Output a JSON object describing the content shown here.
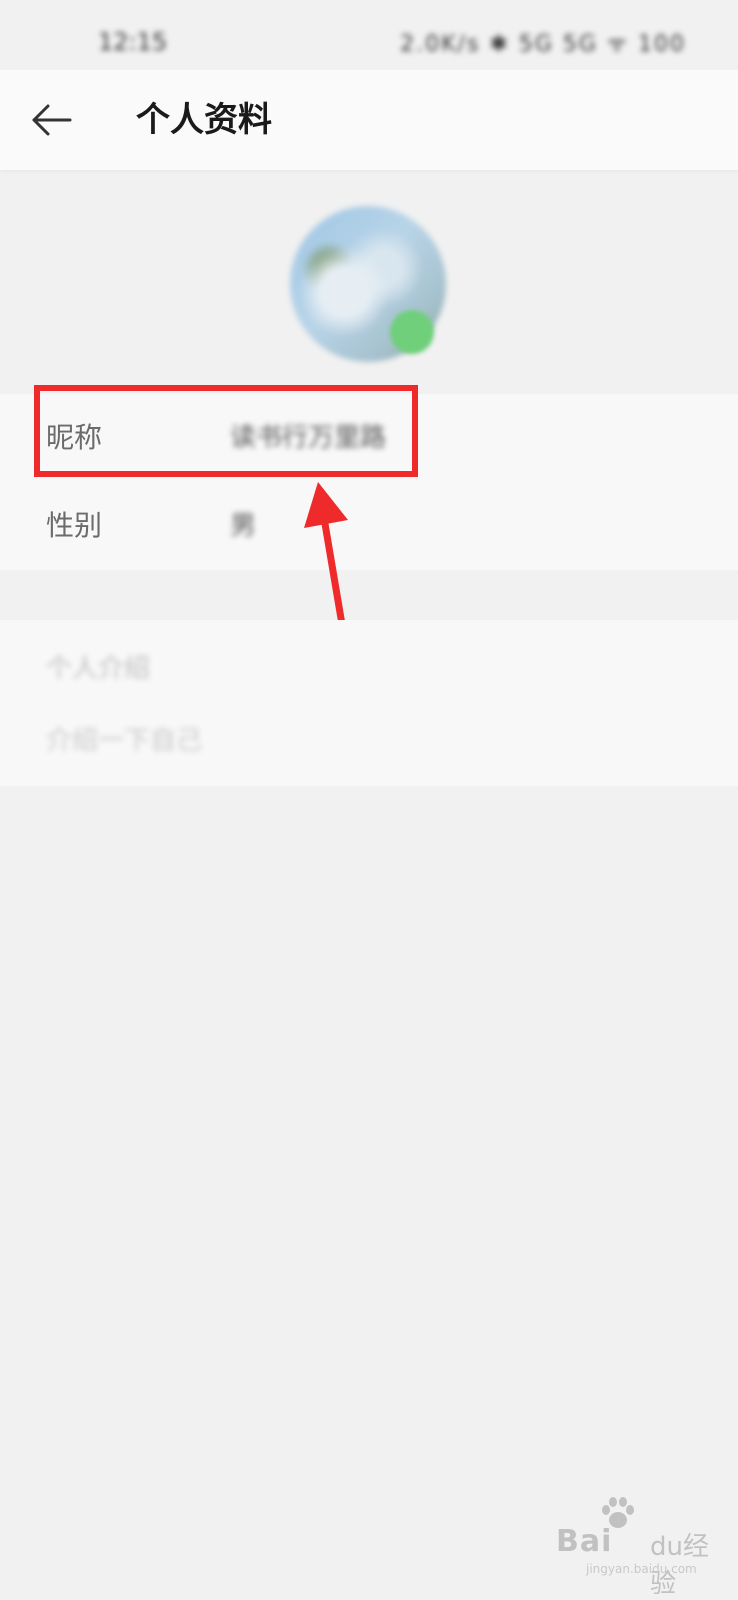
{
  "status_bar": {
    "time": "12:15",
    "indicators": "2.0K/s ✱ 5G 5G ᯤ 100"
  },
  "header": {
    "title": "个人资料",
    "back_icon": "arrow-left-icon"
  },
  "profile": {
    "badge_icon": "wechat-badge-icon",
    "nickname_label": "昵称",
    "nickname_value": "读书行万里路",
    "gender_label": "性别",
    "gender_value": "男"
  },
  "bio": {
    "title": "个人介绍",
    "placeholder": "介绍一下自己"
  },
  "annotation": {
    "highlight_color": "#ee2a2a"
  },
  "watermark": {
    "brand": "Bai",
    "tail": "du经验",
    "url": "jingyan.baidu.com"
  }
}
